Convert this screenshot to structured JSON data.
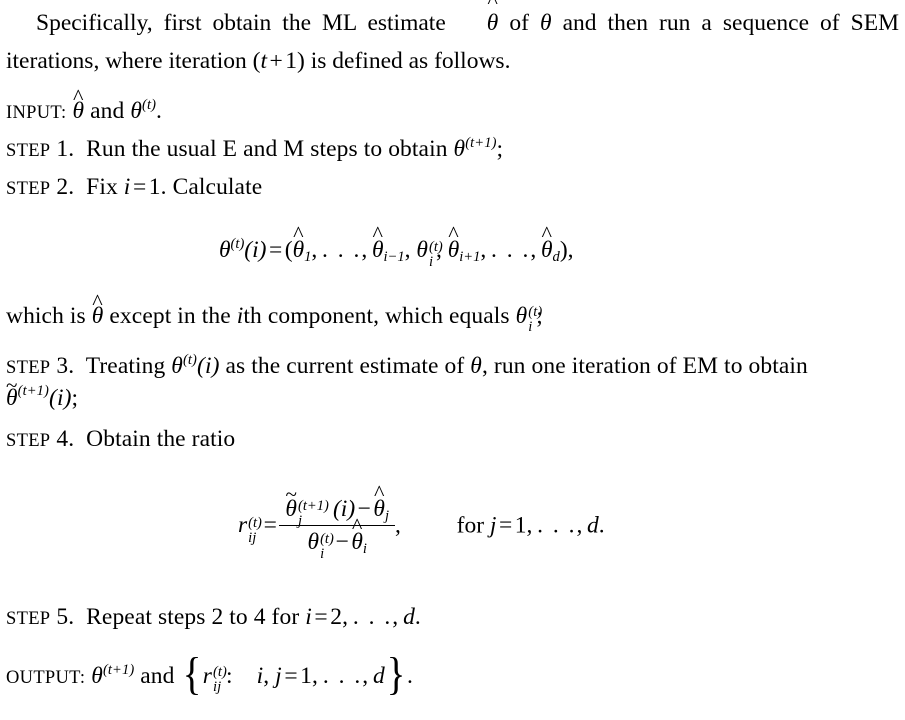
{
  "document": {
    "kind": "academic-paper-excerpt",
    "topic": "SEM (Supplemented EM) algorithm iteration",
    "background_color": "#ffffff",
    "text_color": "#000000"
  },
  "intro_paragraph": {
    "line1_prefix": "Specifically, first obtain the ML estimate ",
    "line1_symbol_hat_theta": "θ̂",
    "line1_mid": " of ",
    "line1_symbol_theta": "θ",
    "line1_suffix": " and then run a sequence of SEM",
    "line2": "iterations, where iteration (t + 1) is defined as follows.",
    "full_text": "Specifically, first obtain the ML estimate θ̂ of θ and then run a sequence of SEM iterations, where iteration (t + 1) is defined as follows."
  },
  "input_line": {
    "label": "INPUT:",
    "symbol_hat_theta": "θ̂",
    "conjunction": "and",
    "symbol_theta_t": "θ⁽ᵗ⁾",
    "terminator": ".",
    "full_text": "INPUT: θ̂ and θ^(t)."
  },
  "steps": [
    {
      "label": "STEP",
      "number": "1.",
      "text_before": "Run the usual E and M steps to obtain",
      "symbol": "θ^(t+1)",
      "terminator": ";",
      "full_text": "STEP 1. Run the usual E and M steps to obtain θ^(t+1);"
    },
    {
      "label": "STEP",
      "number": "2.",
      "text_before": "Fix",
      "assignment": "i = 1.",
      "text_after": "Calculate",
      "full_text": "STEP 2. Fix i = 1. Calculate"
    },
    {
      "label": "STEP",
      "number": "3.",
      "text_before": "Treating",
      "symbol_arg": "θ^(t)(i)",
      "text_mid": "as the current estimate of",
      "symbol_theta": "θ",
      "text_after": ", run one iteration of EM to obtain",
      "continuation": "θ̃^(t+1)(i);",
      "full_text": "STEP 3. Treating θ^(t)(i) as the current estimate of θ, run one iteration of EM to obtain θ̃^(t+1)(i);"
    },
    {
      "label": "STEP",
      "number": "4.",
      "text_before": "Obtain the ratio",
      "full_text": "STEP 4. Obtain the ratio"
    },
    {
      "label": "STEP",
      "number": "5.",
      "text_before": "Repeat steps 2 to 4 for",
      "range": "i = 2, … , d.",
      "full_text": "STEP 5. Repeat steps 2 to 4 for i = 2, …, d."
    }
  ],
  "which_is_line": {
    "prefix": "which is",
    "symbol_hat_theta": "θ̂",
    "mid": "except in the",
    "ith": "i",
    "th": "th component, which equals",
    "symbol": "θ_i^(t)",
    "terminator": ";",
    "full_text": "which is θ̂ except in the ith component, which equals θ_i^(t);"
  },
  "equations": {
    "theta_vector": {
      "lhs_base": "θ",
      "lhs_sup": "(t)",
      "lhs_arg": "(i)",
      "relation": "=",
      "open": "(",
      "terms": [
        "θ̂₁",
        ",",
        "…",
        ",",
        "θ̂_{i−1}",
        ",",
        "θ_i^{(t)}",
        ",",
        "θ̂_{i+1}",
        ",",
        "…",
        ",",
        "θ̂_d"
      ],
      "close": ")",
      "terminator": ",",
      "latex": "\\theta^{(t)}(i) = (\\hat\\theta_1,\\ldots,\\hat\\theta_{i-1},\\ \\theta_i^{(t)},\\ \\hat\\theta_{i+1},\\ldots,\\hat\\theta_d),"
    },
    "ratio": {
      "lhs_base": "r",
      "lhs_sub": "ij",
      "lhs_sup": "(t)",
      "relation": "=",
      "numerator": "θ̃_j^{(t+1)}(i) − θ̂_j",
      "denominator": "θ_i^{(t)} − θ̂_i",
      "terminator": ",",
      "condition": "for j = 1, … , d.",
      "latex": "r_{ij}^{(t)} = \\frac{\\tilde\\theta_j^{(t+1)}(i)-\\hat\\theta_j}{\\theta_i^{(t)}-\\hat\\theta_i},\\qquad \\text{for } j = 1,\\ldots,d."
    }
  },
  "output_line": {
    "label": "OUTPUT:",
    "symbol_theta": "θ^(t+1)",
    "conjunction": "and",
    "brace_open": "{",
    "set_element": "r_ij^(t)",
    "colon": ":",
    "indices": "i, j = 1, … , d",
    "brace_close": "}",
    "terminator": ".",
    "full_text": "OUTPUT: θ^(t+1) and { r_ij^(t) :  i, j = 1, …, d }."
  },
  "glyphs": {
    "theta": "θ",
    "hat": "^",
    "tilde": "~",
    "ellipsis": ". . .",
    "minus": "−",
    "equals": "=",
    "plus": "+"
  }
}
